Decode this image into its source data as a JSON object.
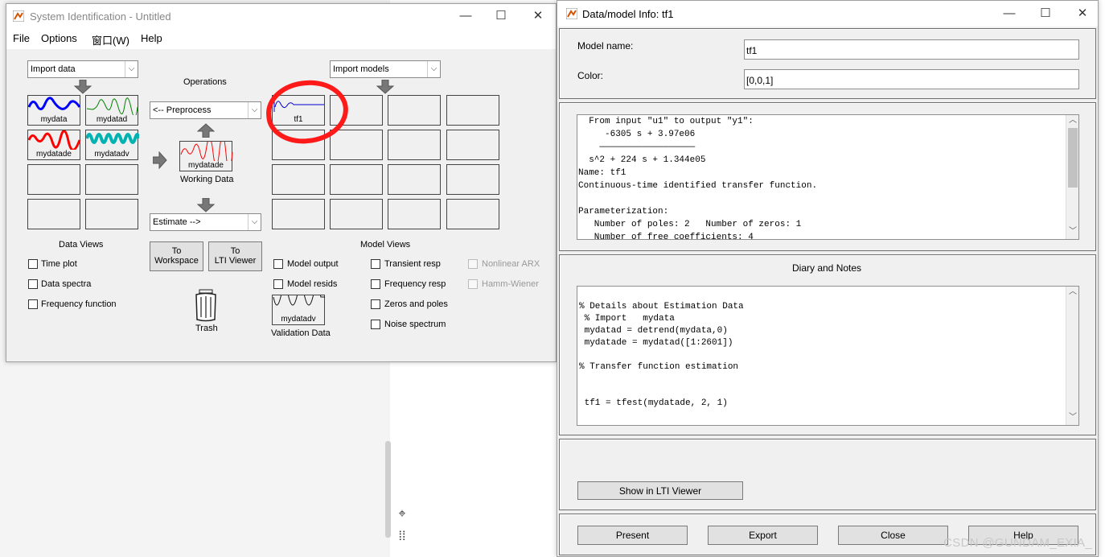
{
  "main_window": {
    "title": "System Identification - Untitled",
    "menu": [
      "File",
      "Options",
      "窗口(W)",
      "Help"
    ],
    "import_data_dropdown": "Import data",
    "import_models_dropdown": "Import models",
    "operations_label": "Operations",
    "preprocess_dropdown": "<-- Preprocess",
    "estimate_dropdown": "Estimate -->",
    "data_tiles": [
      {
        "label": "mydata",
        "color": "#0000ff"
      },
      {
        "label": "mydatad",
        "color": "#008000"
      },
      {
        "label": "mydatade",
        "color": "#ff0000"
      },
      {
        "label": "mydatadv",
        "color": "#00b3b3"
      }
    ],
    "working_data": {
      "tile_label": "mydatade",
      "caption": "Working Data"
    },
    "model_tiles": [
      {
        "label": "tf1",
        "color": "#0000cc"
      }
    ],
    "data_views_title": "Data Views",
    "data_views": [
      "Time plot",
      "Data spectra",
      "Frequency function"
    ],
    "to_workspace": [
      "To",
      "Workspace"
    ],
    "to_lti_viewer": [
      "To",
      "LTI Viewer"
    ],
    "trash_label": "Trash",
    "validation_data": {
      "tile_label": "mydatadv",
      "caption": "Validation Data"
    },
    "model_views_title": "Model Views",
    "model_views_col1": [
      "Model output",
      "Model resids"
    ],
    "model_views_col2": [
      "Transient resp",
      "Frequency resp",
      "Zeros and poles",
      "Noise spectrum"
    ],
    "model_views_col3_disabled": [
      "Nonlinear ARX",
      "Hamm-Wiener"
    ]
  },
  "info_window": {
    "title": "Data/model Info: tf1",
    "model_name_label": "Model name:",
    "model_name_value": "tf1",
    "color_label": "Color:",
    "color_value": "[0,0,1]",
    "info_lines": [
      "  From input \"u1\" to output \"y1\":",
      "     -6305 s + 3.97e06",
      "    ——————————————————",
      "  s^2 + 224 s + 1.344e05",
      "Name: tf1",
      "Continuous-time identified transfer function.",
      "",
      "Parameterization:",
      "   Number of poles: 2   Number of zeros: 1",
      "   Number of free coefficients: 4"
    ],
    "diary_title": "Diary and Notes",
    "diary_lines": [
      "% Details about Estimation Data",
      " % Import   mydata",
      " mydatad = detrend(mydata,0)",
      " mydatade = mydatad([1:2601])",
      "",
      "% Transfer function estimation",
      "",
      "",
      " tf1 = tfest(mydatade, 2, 1)"
    ],
    "show_lti_button": "Show in LTI Viewer",
    "bottom_buttons": [
      "Present",
      "Export",
      "Close",
      "Help"
    ]
  },
  "watermark": "CSDN @GUNDAM_EXIA_"
}
